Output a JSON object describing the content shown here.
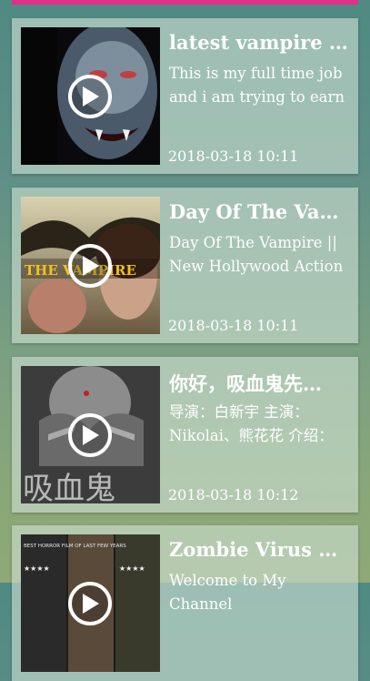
{
  "videos": [
    {
      "title": "latest vampire m…",
      "description": "This is my full time job and i am trying to earn a",
      "date": "2018-03-18 10:11",
      "thumbnail_text": ""
    },
    {
      "title": "Day Of The Vamp…",
      "description": "Day Of The Vampire || New Hollywood Action",
      "date": "2018-03-18 10:11",
      "thumbnail_text": "THE VAMPIRE"
    },
    {
      "title": "你好，吸血鬼先…",
      "description": "导演：白新宇 主演：Nikolai、熊花花 介绍：",
      "date": "2018-03-18 10:12",
      "thumbnail_text": "吸血鬼"
    },
    {
      "title": "Zombie Virus Ho…",
      "description": "Welcome to My Channel",
      "date": "",
      "thumbnail_text": "BEST HORROR FILM OF LAST FEW YEARS"
    }
  ],
  "icons": {
    "play": "play-icon"
  },
  "colors": {
    "accent": "#e0308a"
  }
}
